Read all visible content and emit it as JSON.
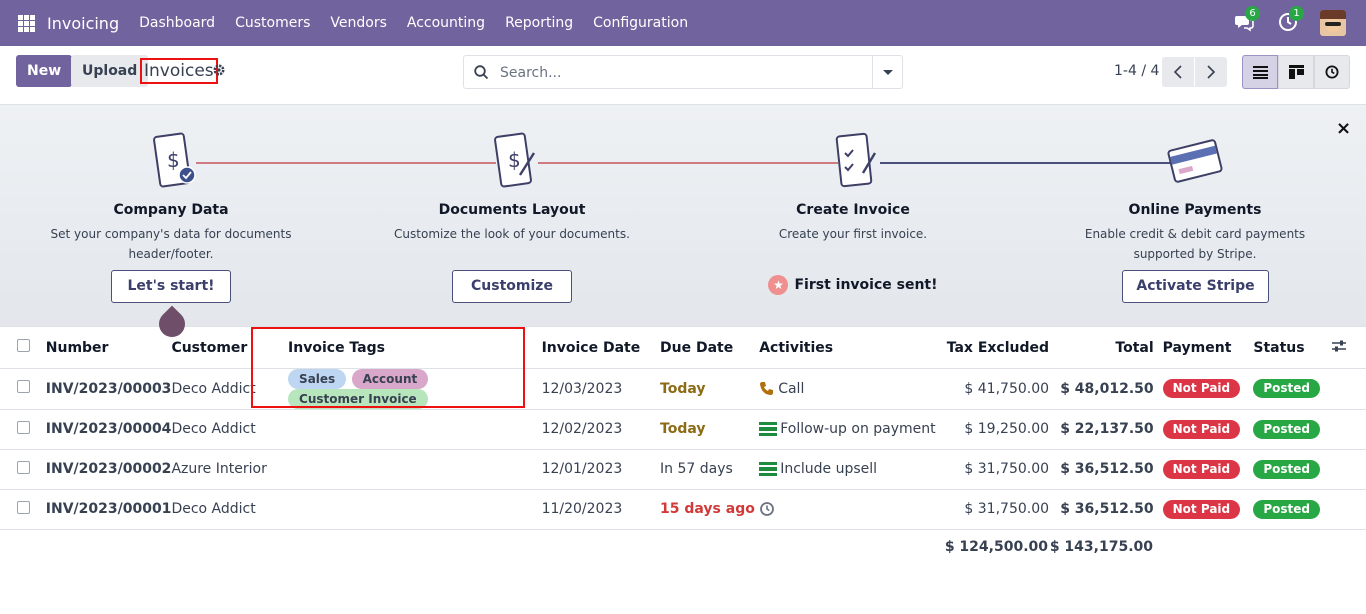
{
  "nav": {
    "app_title": "Invoicing",
    "menu": [
      "Dashboard",
      "Customers",
      "Vendors",
      "Accounting",
      "Reporting",
      "Configuration"
    ],
    "messages_count": "6",
    "activities_count": "1"
  },
  "control": {
    "new_label": "New",
    "upload_label": "Upload",
    "breadcrumb": "Invoices",
    "search_placeholder": "Search...",
    "pager": "1-4 / 4"
  },
  "onboarding": {
    "steps": [
      {
        "title": "Company Data",
        "desc1": "Set your company's data for documents",
        "desc2": "header/footer.",
        "button": "Let's start!"
      },
      {
        "title": "Documents Layout",
        "desc1": "Customize the look of your documents.",
        "desc2": "",
        "button": "Customize"
      },
      {
        "title": "Create Invoice",
        "desc1": "Create your first invoice.",
        "desc2": "",
        "done": "First invoice sent!"
      },
      {
        "title": "Online Payments",
        "desc1": "Enable credit & debit card payments",
        "desc2": "supported by Stripe.",
        "button": "Activate Stripe"
      }
    ],
    "close": "×"
  },
  "table": {
    "headers": {
      "number": "Number",
      "customer": "Customer",
      "tags": "Invoice Tags",
      "invoice_date": "Invoice Date",
      "due_date": "Due Date",
      "activities": "Activities",
      "tax_excluded": "Tax Excluded",
      "total": "Total",
      "payment": "Payment",
      "status": "Status"
    },
    "rows": [
      {
        "number": "INV/2023/00003",
        "customer": "Deco Addict",
        "tags": [
          "Sales",
          "Account",
          "Customer Invoice"
        ],
        "invoice_date": "12/03/2023",
        "due_date": "Today",
        "activity": "Call",
        "tax_excluded": "$ 41,750.00",
        "total": "$ 48,012.50",
        "payment": "Not Paid",
        "status": "Posted"
      },
      {
        "number": "INV/2023/00004",
        "customer": "Deco Addict",
        "tags": [],
        "invoice_date": "12/02/2023",
        "due_date": "Today",
        "activity": "Follow-up on payment",
        "tax_excluded": "$ 19,250.00",
        "total": "$ 22,137.50",
        "payment": "Not Paid",
        "status": "Posted"
      },
      {
        "number": "INV/2023/00002",
        "customer": "Azure Interior",
        "tags": [],
        "invoice_date": "12/01/2023",
        "due_date": "In 57 days",
        "activity": "Include upsell",
        "tax_excluded": "$ 31,750.00",
        "total": "$ 36,512.50",
        "payment": "Not Paid",
        "status": "Posted"
      },
      {
        "number": "INV/2023/00001",
        "customer": "Deco Addict",
        "tags": [],
        "invoice_date": "11/20/2023",
        "due_date": "15 days ago",
        "activity": "",
        "tax_excluded": "$ 31,750.00",
        "total": "$ 36,512.50",
        "payment": "Not Paid",
        "status": "Posted"
      }
    ],
    "totals": {
      "tax_excluded": "$ 124,500.00",
      "total": "$ 143,175.00"
    }
  },
  "colors": {
    "brand": "#71639e",
    "not_paid": "#dc3545",
    "posted": "#28a745",
    "highlight": "#ee1111"
  }
}
